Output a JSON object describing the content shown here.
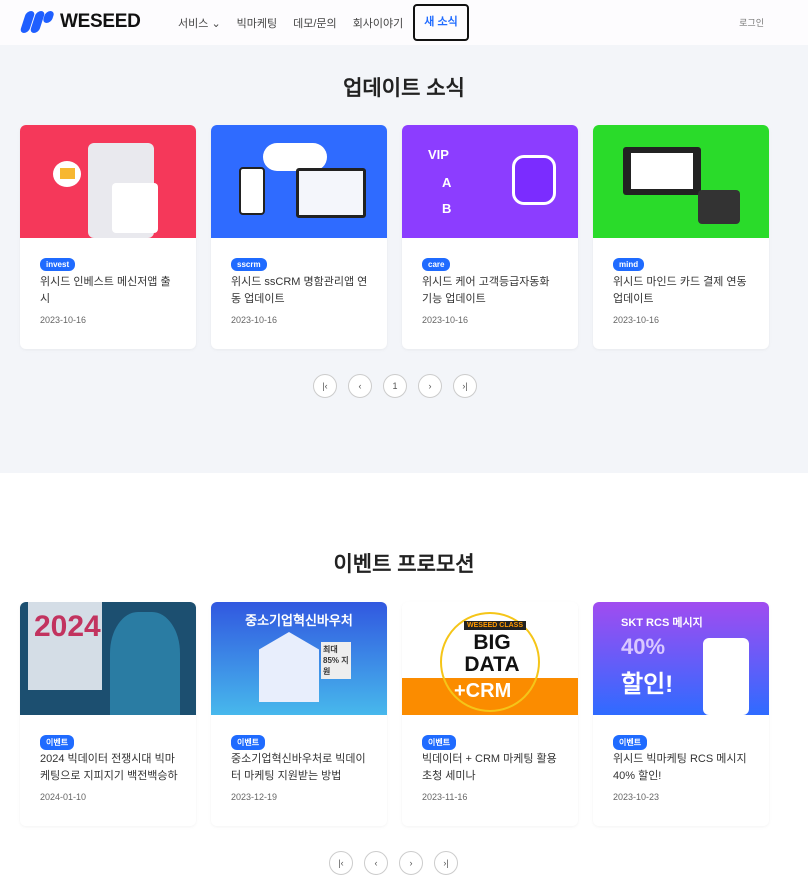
{
  "header": {
    "logo": "WESEED",
    "nav": [
      "서비스",
      "빅마케팅",
      "데모/문의",
      "회사이야기",
      "새 소식"
    ],
    "login": "로그인"
  },
  "updates": {
    "title": "업데이트 소식",
    "cards": [
      {
        "tag": "invest",
        "title": "위시드 인베스트 메신저앱 출시",
        "date": "2023-10-16",
        "color": "#f5385a"
      },
      {
        "tag": "sscrm",
        "title": "위시드 ssCRM 명함관리앱 연동 업데이트",
        "date": "2023-10-16",
        "color": "#2f6bff"
      },
      {
        "tag": "care",
        "title": "위시드 케어 고객등급자동화 기능 업데이트",
        "date": "2023-10-16",
        "color": "#8c3dff"
      },
      {
        "tag": "mind",
        "title": "위시드 마인드 카드 결제 연동 업데이트",
        "date": "2023-10-16",
        "color": "#2adb2a"
      }
    ],
    "page": "1"
  },
  "events": {
    "title": "이벤트 프로모션",
    "cards": [
      {
        "tag": "이벤트",
        "title": "2024 빅데이터 전쟁시대 빅마케팅으로 지피지기 백전백승하",
        "date": "2024-01-10",
        "img": "2024"
      },
      {
        "tag": "이벤트",
        "title": "중소기업혁신바우처로 빅데이터 마케팅 지원받는 방법",
        "date": "2023-12-19",
        "img": "중소기업혁신바우처",
        "img2": "최대 85% 지원"
      },
      {
        "tag": "이벤트",
        "title": "빅데이터 + CRM 마케팅 활용 초청 세미나",
        "date": "2023-11-16",
        "img": "BIG DATA",
        "img2": "+CRM",
        "img3": "WESEED CLASS"
      },
      {
        "tag": "이벤트",
        "title": "위시드 빅마케팅 RCS 메시지 40% 할인!",
        "date": "2023-10-23",
        "img": "SKT RCS 메시지",
        "img2": "40%",
        "img3": "할인!"
      }
    ]
  }
}
